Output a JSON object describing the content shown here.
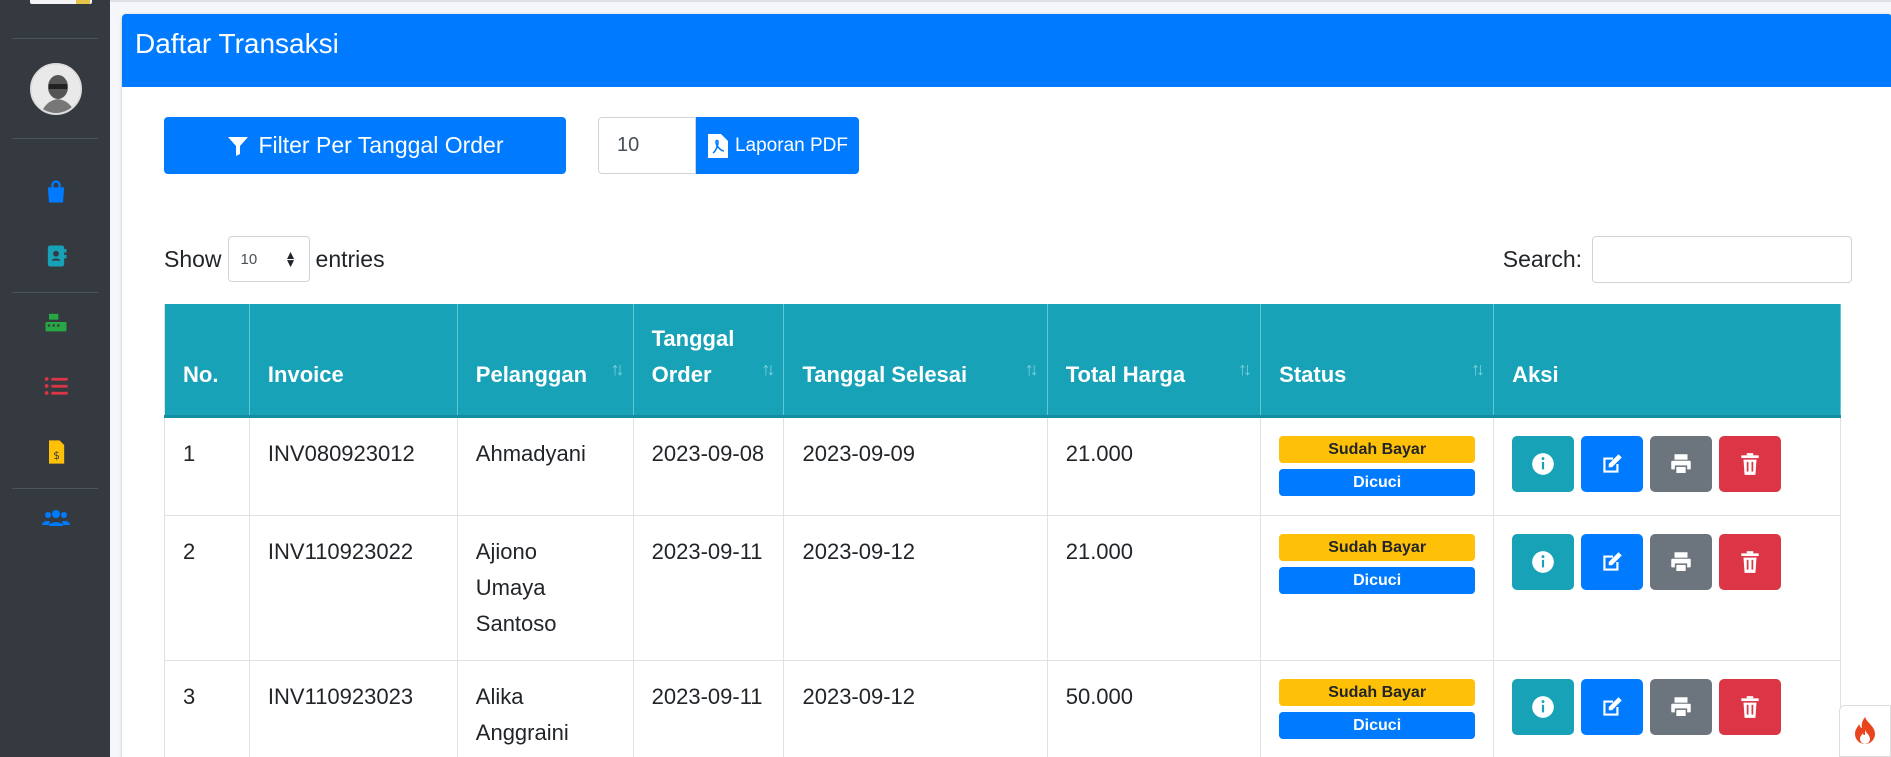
{
  "header": {
    "title": "Daftar Transaksi"
  },
  "toolbar": {
    "filter_label": "Filter Per Tanggal Order",
    "quantity_value": "10",
    "pdf_label": "Laporan PDF"
  },
  "datatable": {
    "show_label": "Show",
    "entries_value": "10",
    "entries_label": "entries",
    "search_label": "Search:"
  },
  "columns": [
    "No.",
    "Invoice",
    "Pelanggan",
    "Tanggal Order",
    "Tanggal Selesai",
    "Total Harga",
    "Status",
    "Aksi"
  ],
  "rows": [
    {
      "no": "1",
      "invoice": "INV080923012",
      "pelanggan": "Ahmadyani",
      "tanggal_order": "2023-09-08",
      "tanggal_selesai": "2023-09-09",
      "total": "21.000",
      "payment": "Sudah Bayar",
      "status": "Dicuci"
    },
    {
      "no": "2",
      "invoice": "INV110923022",
      "pelanggan": "Ajiono Umaya Santoso",
      "tanggal_order": "2023-09-11",
      "tanggal_selesai": "2023-09-12",
      "total": "21.000",
      "payment": "Sudah Bayar",
      "status": "Dicuci"
    },
    {
      "no": "3",
      "invoice": "INV110923023",
      "pelanggan": "Alika Anggraini",
      "tanggal_order": "2023-09-11",
      "tanggal_selesai": "2023-09-12",
      "total": "50.000",
      "payment": "Sudah Bayar",
      "status": "Dicuci"
    }
  ],
  "sidebar": {
    "icons": [
      "shopping-bag-icon",
      "address-book-icon",
      "cash-register-icon",
      "list-icon",
      "invoice-dollar-icon",
      "users-icon"
    ]
  },
  "colors": {
    "primary": "#007bff",
    "info": "#17a2b8",
    "warning": "#ffc107",
    "secondary": "#6c757d",
    "danger": "#dc3545",
    "sidebar": "#343a40"
  }
}
